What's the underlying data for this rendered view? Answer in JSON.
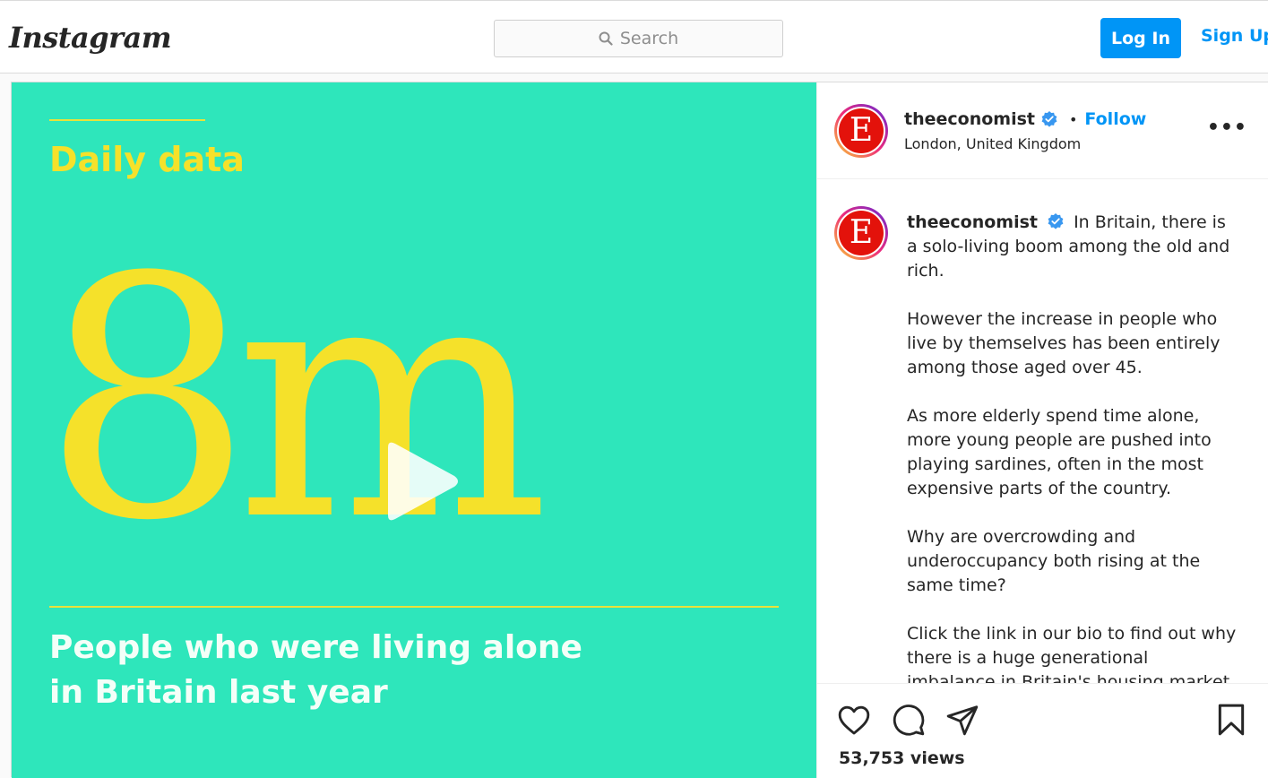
{
  "header": {
    "logo": "Instagram",
    "search_placeholder": "Search",
    "login_label": "Log In",
    "signup_label": "Sign Up"
  },
  "media": {
    "kicker": "Daily data",
    "big_number": "8m",
    "caption_line1": "People who were living alone",
    "caption_line2": "in Britain last year",
    "play_icon": "play-icon"
  },
  "post": {
    "username": "theeconomist",
    "follow_label": "Follow",
    "location": "London, United Kingdom",
    "avatar_letter": "E",
    "caption_intro": "In Britain, there is a solo-living boom among the old and rich.",
    "paragraphs": [
      "However the increase in people who live by themselves has been entirely among those aged over 45.",
      "As more elderly spend time alone, more young people are pushed into playing sardines, often in the most expensive parts of the country.",
      "Why are overcrowding and underoccupancy both rising at the same time?",
      "Click the link in our bio to find out why there is a huge generational imbalance in Britain's housing market"
    ],
    "views": "53,753 views"
  },
  "colors": {
    "media_bg": "#2ee6bb",
    "media_yellow": "#f5e12a",
    "accent_blue": "#0095f6",
    "economist_red": "#e3120b"
  }
}
